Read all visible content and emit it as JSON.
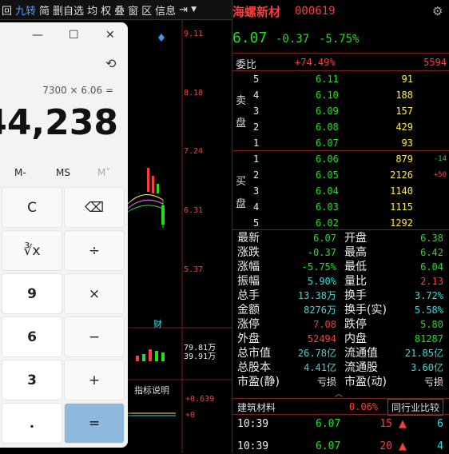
{
  "toolbar": {
    "items": [
      "回",
      "九转",
      "简",
      "删自选",
      "均",
      "权",
      "叠",
      "窗",
      "区",
      "信息"
    ],
    "active_index": 1
  },
  "chart": {
    "price_levels": [
      "9.11",
      "8.18",
      "7.24",
      "6.31",
      "5.37"
    ],
    "label_cai": "财",
    "vol_labels": [
      "79.81万",
      "39.91万"
    ],
    "indicator_label": "指标说明",
    "ind_values": [
      "+0.639",
      "+0"
    ]
  },
  "calculator": {
    "expression": "7300 × 6.06 =",
    "result": "44,238",
    "memory": [
      "M-",
      "MS",
      "M˅"
    ],
    "keys": [
      {
        "label": "C",
        "kind": "op"
      },
      {
        "label": "⌫",
        "kind": "op"
      },
      {
        "label": "∛x",
        "kind": "op"
      },
      {
        "label": "÷",
        "kind": "op"
      },
      {
        "label": "9",
        "kind": "num"
      },
      {
        "label": "×",
        "kind": "op"
      },
      {
        "label": "6",
        "kind": "num"
      },
      {
        "label": "−",
        "kind": "op"
      },
      {
        "label": "3",
        "kind": "num"
      },
      {
        "label": "+",
        "kind": "op"
      },
      {
        "label": ".",
        "kind": "num"
      },
      {
        "label": "=",
        "kind": "eq"
      }
    ]
  },
  "stock": {
    "name": "海螺新材",
    "code": "000619",
    "price": "6.07",
    "change": "-0.37",
    "pct": "-5.75%",
    "weibi_label": "委比",
    "weibi_pct": "+74.49%",
    "weibi_val": "5594",
    "sell_label": [
      "卖",
      "盘"
    ],
    "buy_label": [
      "买",
      "盘"
    ],
    "asks": [
      {
        "lvl": "5",
        "price": "6.11",
        "vol": "91",
        "delta": ""
      },
      {
        "lvl": "4",
        "price": "6.10",
        "vol": "188",
        "delta": ""
      },
      {
        "lvl": "3",
        "price": "6.09",
        "vol": "157",
        "delta": ""
      },
      {
        "lvl": "2",
        "price": "6.08",
        "vol": "429",
        "delta": ""
      },
      {
        "lvl": "1",
        "price": "6.07",
        "vol": "93",
        "delta": ""
      }
    ],
    "bids": [
      {
        "lvl": "1",
        "price": "6.06",
        "vol": "879",
        "delta": "-14"
      },
      {
        "lvl": "2",
        "price": "6.05",
        "vol": "2126",
        "delta": "+50"
      },
      {
        "lvl": "3",
        "price": "6.04",
        "vol": "1140",
        "delta": ""
      },
      {
        "lvl": "4",
        "price": "6.03",
        "vol": "1115",
        "delta": ""
      },
      {
        "lvl": "5",
        "price": "6.02",
        "vol": "1292",
        "delta": ""
      }
    ],
    "stats": [
      {
        "l1": "最新",
        "v1": "6.07",
        "c1": "green",
        "l2": "开盘",
        "v2": "6.38",
        "c2": "green"
      },
      {
        "l1": "涨跌",
        "v1": "-0.37",
        "c1": "green",
        "l2": "最高",
        "v2": "6.42",
        "c2": "green"
      },
      {
        "l1": "涨幅",
        "v1": "-5.75%",
        "c1": "green",
        "l2": "最低",
        "v2": "6.04",
        "c2": "green"
      },
      {
        "l1": "振幅",
        "v1": "5.90%",
        "c1": "cyan",
        "l2": "量比",
        "v2": "2.13",
        "c2": "red"
      },
      {
        "l1": "总手",
        "v1": "13.38万",
        "c1": "cyan",
        "l2": "换手",
        "v2": "3.72%",
        "c2": "cyan"
      },
      {
        "l1": "金额",
        "v1": "8276万",
        "c1": "cyan",
        "l2": "换手(实)",
        "v2": "5.58%",
        "c2": "cyan"
      },
      {
        "l1": "涨停",
        "v1": "7.08",
        "c1": "red",
        "l2": "跌停",
        "v2": "5.80",
        "c2": "green"
      },
      {
        "l1": "外盘",
        "v1": "52494",
        "c1": "red",
        "l2": "内盘",
        "v2": "81287",
        "c2": "green"
      },
      {
        "l1": "总市值",
        "v1": "26.78亿",
        "c1": "cyan",
        "l2": "流通值",
        "v2": "21.85亿",
        "c2": "cyan"
      },
      {
        "l1": "总股本",
        "v1": "4.41亿",
        "c1": "cyan",
        "l2": "流通股",
        "v2": "3.60亿",
        "c2": "cyan"
      },
      {
        "l1": "市盈(静)",
        "v1": "亏损",
        "c1": "white",
        "l2": "市盈(动)",
        "v2": "亏损",
        "c2": "white"
      }
    ],
    "sector_name": "建筑材料",
    "sector_pct": "0.06%",
    "compare_label": "同行业比较",
    "ticks": [
      {
        "time": "10:39",
        "price": "6.07",
        "vol": "15",
        "n": "6"
      },
      {
        "time": "10:39",
        "price": "6.07",
        "vol": "20",
        "n": "4"
      }
    ]
  }
}
